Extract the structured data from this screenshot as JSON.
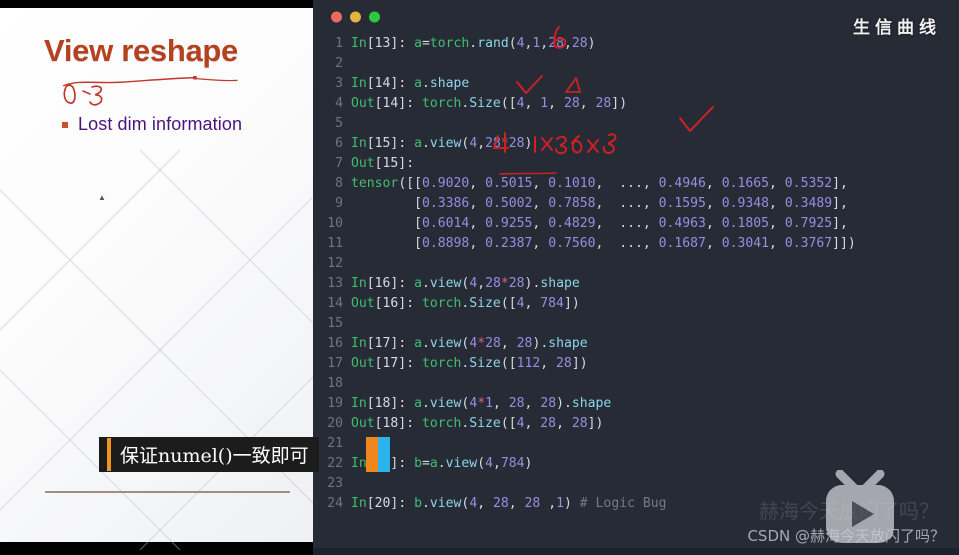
{
  "slide": {
    "title": "View reshape",
    "bullet": "Lost dim information",
    "bullet_icon": "square-bullet-icon",
    "tiny_mark": "▲",
    "hand_annotation": "0~3",
    "title_color": "#b5421f",
    "bullet_color": "#4b137e",
    "rule_color": "#a08e7f"
  },
  "terminal": {
    "window_controls": [
      {
        "name": "close-button",
        "color": "#ec6a5e"
      },
      {
        "name": "minimize-button",
        "color": "#e3b341"
      },
      {
        "name": "maximize-button",
        "color": "#2bc840"
      }
    ],
    "corner_text": "生信曲线",
    "background": "#262b36",
    "lines": [
      {
        "n": "1",
        "prompt": "In",
        "idx": "[13]",
        "code": "a=torch.rand(4,1,28,28)"
      },
      {
        "n": "2",
        "prompt": "",
        "idx": "",
        "code": ""
      },
      {
        "n": "3",
        "prompt": "In",
        "idx": "[14]",
        "code": "a.shape"
      },
      {
        "n": "4",
        "prompt": "Out",
        "idx": "[14]",
        "code": "torch.Size([4, 1, 28, 28])"
      },
      {
        "n": "5",
        "prompt": "",
        "idx": "",
        "code": ""
      },
      {
        "n": "6",
        "prompt": "In",
        "idx": "[15]",
        "code": "a.view(4,28*28)"
      },
      {
        "n": "7",
        "prompt": "Out",
        "idx": "[15]",
        "code": ""
      },
      {
        "n": "8",
        "prompt": "",
        "idx": "",
        "code": "tensor([[0.9020, 0.5015, 0.1010,  ..., 0.4946, 0.1665, 0.5352],"
      },
      {
        "n": "9",
        "prompt": "",
        "idx": "",
        "code": "        [0.3386, 0.5002, 0.7858,  ..., 0.1595, 0.9348, 0.3489],"
      },
      {
        "n": "10",
        "prompt": "",
        "idx": "",
        "code": "        [0.6014, 0.9255, 0.4829,  ..., 0.4963, 0.1805, 0.7925],"
      },
      {
        "n": "11",
        "prompt": "",
        "idx": "",
        "code": "        [0.8898, 0.2387, 0.7560,  ..., 0.1687, 0.3041, 0.3767]])"
      },
      {
        "n": "12",
        "prompt": "",
        "idx": "",
        "code": ""
      },
      {
        "n": "13",
        "prompt": "In",
        "idx": "[16]",
        "code": "a.view(4,28*28).shape"
      },
      {
        "n": "14",
        "prompt": "Out",
        "idx": "[16]",
        "code": "torch.Size([4, 784])"
      },
      {
        "n": "15",
        "prompt": "",
        "idx": "",
        "code": ""
      },
      {
        "n": "16",
        "prompt": "In",
        "idx": "[17]",
        "code": "a.view(4*28, 28).shape"
      },
      {
        "n": "17",
        "prompt": "Out",
        "idx": "[17]",
        "code": "torch.Size([112, 28])"
      },
      {
        "n": "18",
        "prompt": "",
        "idx": "",
        "code": ""
      },
      {
        "n": "19",
        "prompt": "In",
        "idx": "[18]",
        "code": "a.view(4*1, 28, 28).shape"
      },
      {
        "n": "20",
        "prompt": "Out",
        "idx": "[18]",
        "code": "torch.Size([4, 28, 28])"
      },
      {
        "n": "21",
        "prompt": "",
        "idx": "",
        "code": ""
      },
      {
        "n": "22",
        "prompt": "In",
        "idx": "[19]",
        "code": "b=a.view(4,784)"
      },
      {
        "n": "23",
        "prompt": "",
        "idx": "",
        "code": ""
      },
      {
        "n": "24",
        "prompt": "In",
        "idx": "[20]",
        "code": "b.view(4, 28, 28 ,1) # Logic Bug"
      }
    ]
  },
  "annotations": {
    "color": "#cc2222",
    "items": [
      {
        "name": "hand-letter-b",
        "text": "b"
      },
      {
        "name": "hand-checkmark-1",
        "text": "✓"
      },
      {
        "name": "hand-triangle",
        "text": "△"
      },
      {
        "name": "hand-checkmark-2",
        "text": "✓"
      },
      {
        "name": "hand-dims",
        "text": "4  1x28x28"
      },
      {
        "name": "hand-underline",
        "text": ""
      }
    ]
  },
  "subtitle": {
    "text": "保证numel()一致即可",
    "left_bar_color": "#f0961e",
    "bar_orange": "#f0861e",
    "bar_blue": "#2bb3ec"
  },
  "watermarks": {
    "bilibili_logo": "tv-play-icon",
    "csdn": "CSDN @赫海今天放闪了吗？",
    "ghost": "赫海今天放闪了吗？"
  }
}
